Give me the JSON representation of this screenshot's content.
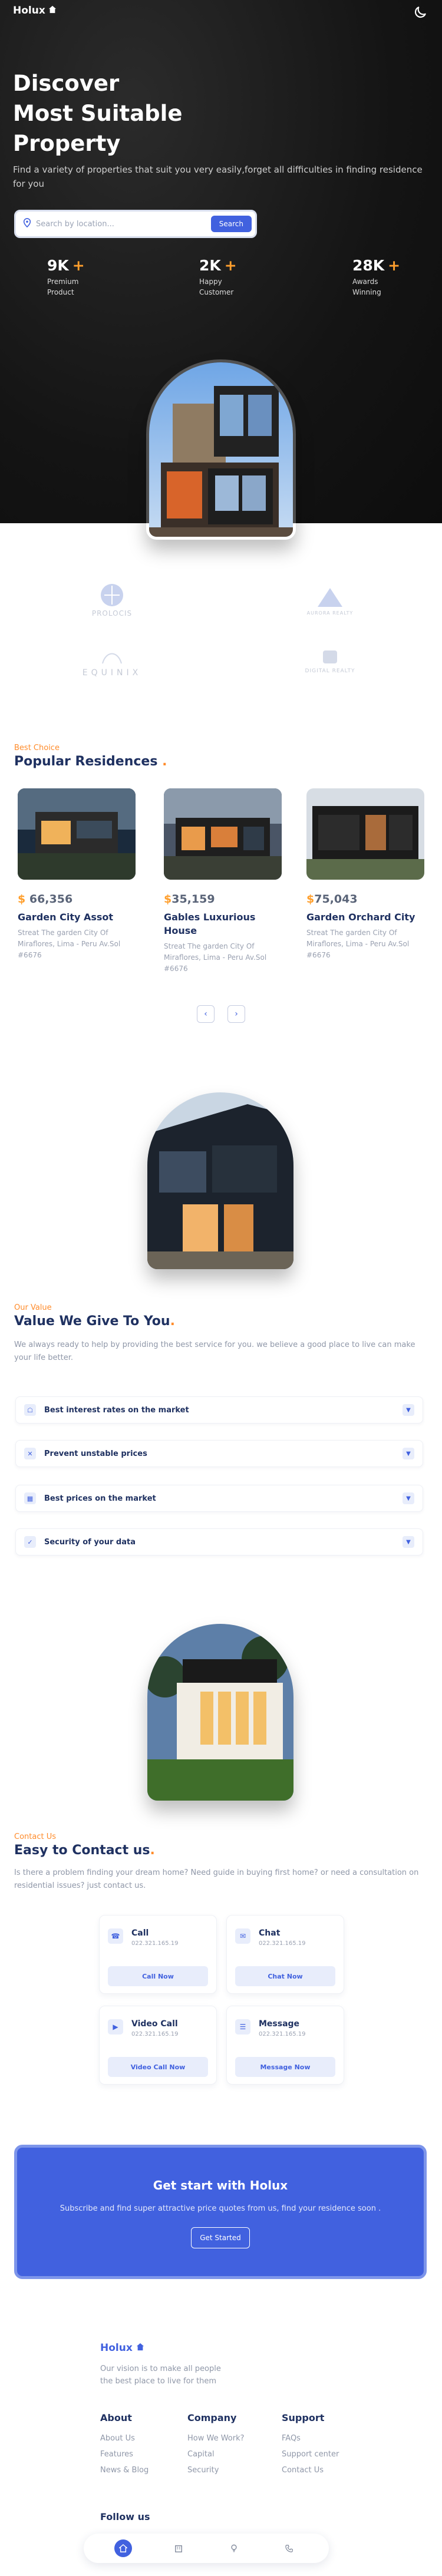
{
  "header": {
    "logo_text": "Holux",
    "logo_icon": "home-icon",
    "theme_icon": "moon-icon"
  },
  "hero": {
    "title_line1": "Discover",
    "title_line2": "Most Suitable",
    "title_line3": "Property",
    "description": "Find a variety of properties that suit you very easily,forget all difficulties in finding residence for you",
    "search_placeholder": "Search by location...",
    "search_button": "Search",
    "stats": [
      {
        "value": "9K",
        "plus": "+",
        "label": "Premium Product"
      },
      {
        "value": "2K",
        "plus": "+",
        "label": "Happy Customer"
      },
      {
        "value": "28K",
        "plus": "+",
        "label": "Awards Winning"
      }
    ]
  },
  "companies": [
    "PROLOCIS",
    "AURORA REALTY",
    "EQUINIX",
    "DIGITAL REALTY"
  ],
  "residences": {
    "kicker": "Best Choice",
    "title": "Popular Residences",
    "title_dot": ".",
    "cards": [
      {
        "currency": "$",
        "price": "66,356",
        "name": "Garden City Assot",
        "address": "Streat The garden City Of Miraflores, Lima - Peru Av.Sol #6676"
      },
      {
        "currency": "$",
        "price": "35,159",
        "name": "Gables Luxurious House",
        "address": "Streat The garden City Of Miraflores, Lima - Peru Av.Sol #6676"
      },
      {
        "currency": "$",
        "price": "75,043",
        "name": "Garden Orchard City",
        "address": "Streat The garden City Of Miraflores, Lima - Peru Av.Sol #6676"
      }
    ],
    "prev_icon": "chevron-left-icon",
    "next_icon": "chevron-right-icon"
  },
  "value": {
    "kicker": "Our Value",
    "title": "Value We Give To You",
    "title_dot": ".",
    "description": "We always ready to help by providing the best service for you. we believe a good place to live can make your life better.",
    "items": [
      {
        "label": "Best interest rates on the market",
        "icon": "shield-icon"
      },
      {
        "label": "Prevent unstable prices",
        "icon": "close-icon"
      },
      {
        "label": "Best prices on the market",
        "icon": "chart-icon"
      },
      {
        "label": "Security of your data",
        "icon": "check-icon"
      }
    ]
  },
  "contact": {
    "kicker": "Contact Us",
    "title": "Easy to Contact us",
    "title_dot": ".",
    "description": "Is there a problem finding your dream home? Need guide in buying first home? or need a consultation on residential issues? just contact us.",
    "boxes": [
      {
        "title": "Call",
        "number": "022.321.165.19",
        "button": "Call Now",
        "icon": "phone-icon"
      },
      {
        "title": "Chat",
        "number": "022.321.165.19",
        "button": "Chat Now",
        "icon": "chat-icon"
      },
      {
        "title": "Video Call",
        "number": "022.321.165.19",
        "button": "Video Call Now",
        "icon": "video-icon"
      },
      {
        "title": "Message",
        "number": "022.321.165.19",
        "button": "Message Now",
        "icon": "message-icon"
      }
    ]
  },
  "cta": {
    "title": "Get start with Holux",
    "description": "Subscribe and find super attractive price quotes from us, find your residence soon .",
    "button": "Get Started"
  },
  "footer": {
    "logo_text": "Holux",
    "tagline": "Our vision is to make all people the best place to live for them",
    "columns": [
      {
        "title": "About",
        "links": [
          "About Us",
          "Features",
          "News & Blog"
        ]
      },
      {
        "title": "Company",
        "links": [
          "How We Work?",
          "Capital",
          "Security"
        ]
      },
      {
        "title": "Support",
        "links": [
          "FAQs",
          "Support center",
          "Contact Us"
        ]
      }
    ],
    "follow_title": "Follow us"
  },
  "bottom_nav": [
    "home-icon",
    "building-icon",
    "bulb-icon",
    "phone-icon"
  ],
  "colors": {
    "accent": "#4161df",
    "orange": "#ff8b2a",
    "navy": "#1f3161",
    "hero_bg": "#141414"
  }
}
